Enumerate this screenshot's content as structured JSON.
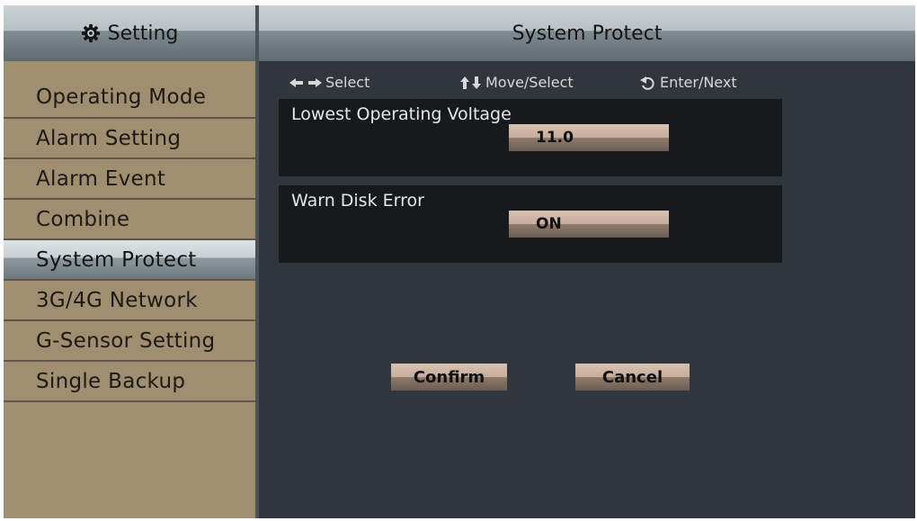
{
  "sidebar": {
    "title": "Setting",
    "items": [
      {
        "label": "Operating Mode"
      },
      {
        "label": "Alarm Setting"
      },
      {
        "label": "Alarm Event"
      },
      {
        "label": "Combine"
      },
      {
        "label": "System Protect"
      },
      {
        "label": "3G/4G Network"
      },
      {
        "label": "G-Sensor Setting"
      },
      {
        "label": "Single Backup"
      }
    ],
    "active_item": "System Protect"
  },
  "main": {
    "title": "System Protect",
    "hints": {
      "select": "Select",
      "move_select": "Move/Select",
      "enter_next": "Enter/Next"
    },
    "settings": [
      {
        "label": "Lowest Operating Voltage",
        "value": "11.0"
      },
      {
        "label": "Warn Disk Error",
        "value": "ON"
      }
    ],
    "buttons": {
      "confirm": "Confirm",
      "cancel": "Cancel"
    }
  },
  "icons": {
    "title": "gear-icon",
    "hint_select": "left-right-arrows-icon",
    "hint_move": "up-down-arrows-icon",
    "hint_enter": "enter-return-icon"
  },
  "colors": {
    "sidebar_bg": "#a08e70",
    "main_bg": "#30363b",
    "panel_bg": "#171a1d",
    "value_box": "#c6ad9c",
    "header": "#b8c2c6"
  }
}
